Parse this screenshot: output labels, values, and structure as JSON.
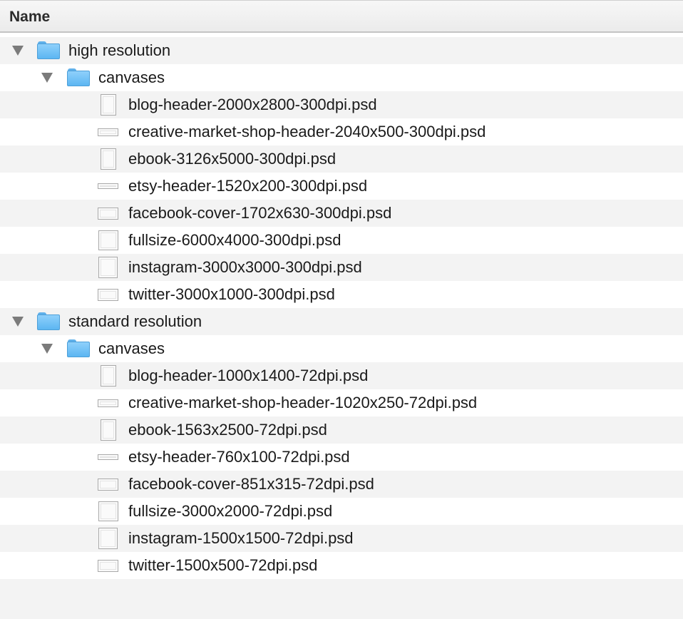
{
  "header": {
    "name_column": "Name"
  },
  "rows": [
    {
      "label": "high resolution",
      "kind": "folder",
      "level": 0,
      "expanded": true,
      "icon": "folder-icon"
    },
    {
      "label": "canvases",
      "kind": "folder",
      "level": 1,
      "expanded": true,
      "icon": "folder-icon"
    },
    {
      "label": "blog-header-2000x2800-300dpi.psd",
      "kind": "file",
      "level": 2,
      "icon": "document-icon"
    },
    {
      "label": "creative-market-shop-header-2040x500-300dpi.psd",
      "kind": "file",
      "level": 2,
      "icon": "document-icon"
    },
    {
      "label": "ebook-3126x5000-300dpi.psd",
      "kind": "file",
      "level": 2,
      "icon": "document-icon"
    },
    {
      "label": "etsy-header-1520x200-300dpi.psd",
      "kind": "file",
      "level": 2,
      "icon": "document-icon"
    },
    {
      "label": "facebook-cover-1702x630-300dpi.psd",
      "kind": "file",
      "level": 2,
      "icon": "document-icon"
    },
    {
      "label": "fullsize-6000x4000-300dpi.psd",
      "kind": "file",
      "level": 2,
      "icon": "document-icon"
    },
    {
      "label": "instagram-3000x3000-300dpi.psd",
      "kind": "file",
      "level": 2,
      "icon": "document-icon"
    },
    {
      "label": "twitter-3000x1000-300dpi.psd",
      "kind": "file",
      "level": 2,
      "icon": "document-icon"
    },
    {
      "label": "standard resolution",
      "kind": "folder",
      "level": 0,
      "expanded": true,
      "icon": "folder-icon"
    },
    {
      "label": "canvases",
      "kind": "folder",
      "level": 1,
      "expanded": true,
      "icon": "folder-icon"
    },
    {
      "label": "blog-header-1000x1400-72dpi.psd",
      "kind": "file",
      "level": 2,
      "icon": "document-icon"
    },
    {
      "label": "creative-market-shop-header-1020x250-72dpi.psd",
      "kind": "file",
      "level": 2,
      "icon": "document-icon"
    },
    {
      "label": "ebook-1563x2500-72dpi.psd",
      "kind": "file",
      "level": 2,
      "icon": "document-icon"
    },
    {
      "label": "etsy-header-760x100-72dpi.psd",
      "kind": "file",
      "level": 2,
      "icon": "document-icon"
    },
    {
      "label": "facebook-cover-851x315-72dpi.psd",
      "kind": "file",
      "level": 2,
      "icon": "document-icon"
    },
    {
      "label": "fullsize-3000x2000-72dpi.psd",
      "kind": "file",
      "level": 2,
      "icon": "document-icon"
    },
    {
      "label": "instagram-1500x1500-72dpi.psd",
      "kind": "file",
      "level": 2,
      "icon": "document-icon"
    },
    {
      "label": "twitter-1500x500-72dpi.psd",
      "kind": "file",
      "level": 2,
      "icon": "document-icon"
    }
  ]
}
